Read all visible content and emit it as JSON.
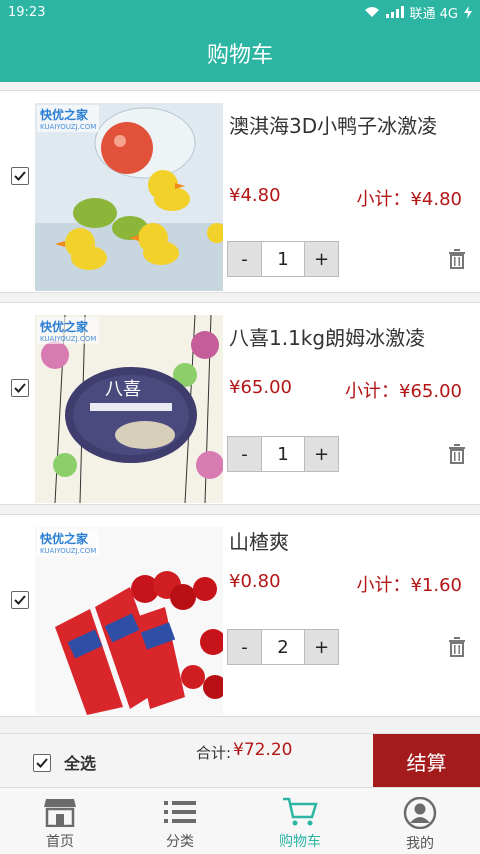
{
  "status": {
    "time": "19:23",
    "carrier": "联通 4G"
  },
  "header": {
    "title": "购物车"
  },
  "items": [
    {
      "name": "澳淇海3D小鸭子冰激凌",
      "price": "¥4.80",
      "subtotal": "小计：¥4.80",
      "qty": "1",
      "checked": true,
      "watermark": "快优之家",
      "watermark_sub": "KUAIYOUZJ.COM"
    },
    {
      "name": "八喜1.1kg朗姆冰激凌",
      "price": "¥65.00",
      "subtotal": "小计：¥65.00",
      "qty": "1",
      "checked": true,
      "watermark": "快优之家",
      "watermark_sub": "KUAIYOUZJ.COM"
    },
    {
      "name": "山楂爽",
      "price": "¥0.80",
      "subtotal": "小计：¥1.60",
      "qty": "2",
      "checked": true,
      "watermark": "快优之家",
      "watermark_sub": "KUAIYOUZJ.COM"
    }
  ],
  "stepper": {
    "minus": "-",
    "plus": "+"
  },
  "footer": {
    "select_all": "全选",
    "total_label": "合计:",
    "total": "¥72.20",
    "checkout": "结算"
  },
  "tabs": [
    {
      "label": "首页",
      "icon": "store-icon"
    },
    {
      "label": "分类",
      "icon": "list-icon"
    },
    {
      "label": "购物车",
      "icon": "cart-icon",
      "active": true
    },
    {
      "label": "我的",
      "icon": "user-icon"
    }
  ],
  "colors": {
    "primary": "#2bb5a2",
    "price": "#b41616",
    "checkout": "#a31b1b"
  }
}
